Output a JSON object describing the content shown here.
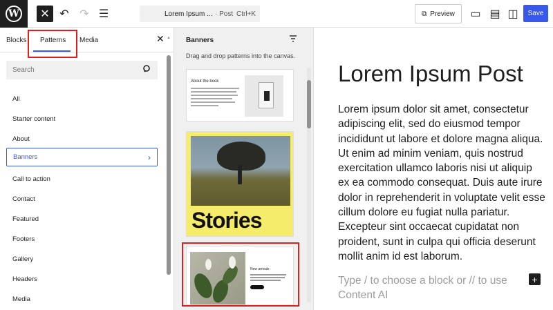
{
  "toolbar": {
    "doc_title": "Lorem Ipsum ...",
    "doc_type": "· Post",
    "shortcut": "Ctrl+K",
    "preview_label": "Preview",
    "save_label": "Save"
  },
  "inserter": {
    "tabs": [
      {
        "label": "Blocks"
      },
      {
        "label": "Patterns",
        "active": true
      },
      {
        "label": "Media"
      }
    ],
    "search_placeholder": "Search",
    "categories": [
      {
        "label": "All"
      },
      {
        "label": "Starter content"
      },
      {
        "label": "About"
      },
      {
        "label": "Banners",
        "selected": true
      },
      {
        "label": "Call to action"
      },
      {
        "label": "Contact"
      },
      {
        "label": "Featured"
      },
      {
        "label": "Footers"
      },
      {
        "label": "Gallery"
      },
      {
        "label": "Headers"
      },
      {
        "label": "Media"
      }
    ]
  },
  "patterns": {
    "heading": "Banners",
    "description": "Drag and drop patterns into the canvas.",
    "card1_title": "About the book",
    "card2_word": "Stories",
    "card3_title": "New arrivals"
  },
  "editor": {
    "title": "Lorem Ipsum Post",
    "body": "Lorem ipsum dolor sit amet, consectetur adipiscing elit, sed do eiusmod tempor incididunt ut labore et dolore magna aliqua. Ut enim ad minim veniam, quis nostrud exercitation ullamco laboris nisi ut aliquip ex ea commodo consequat. Duis aute irure dolor in reprehenderit in voluptate velit esse cillum dolore eu fugiat nulla pariatur. Excepteur sint occaecat cupidatat non proident, sunt in culpa qui officia deserunt mollit anim id est laborum.",
    "placeholder": "Type / to choose a block or // to use Content AI"
  },
  "colors": {
    "accent": "#3858e9",
    "highlight": "#e01e1e",
    "banner_bg": "#f5ec6b"
  }
}
